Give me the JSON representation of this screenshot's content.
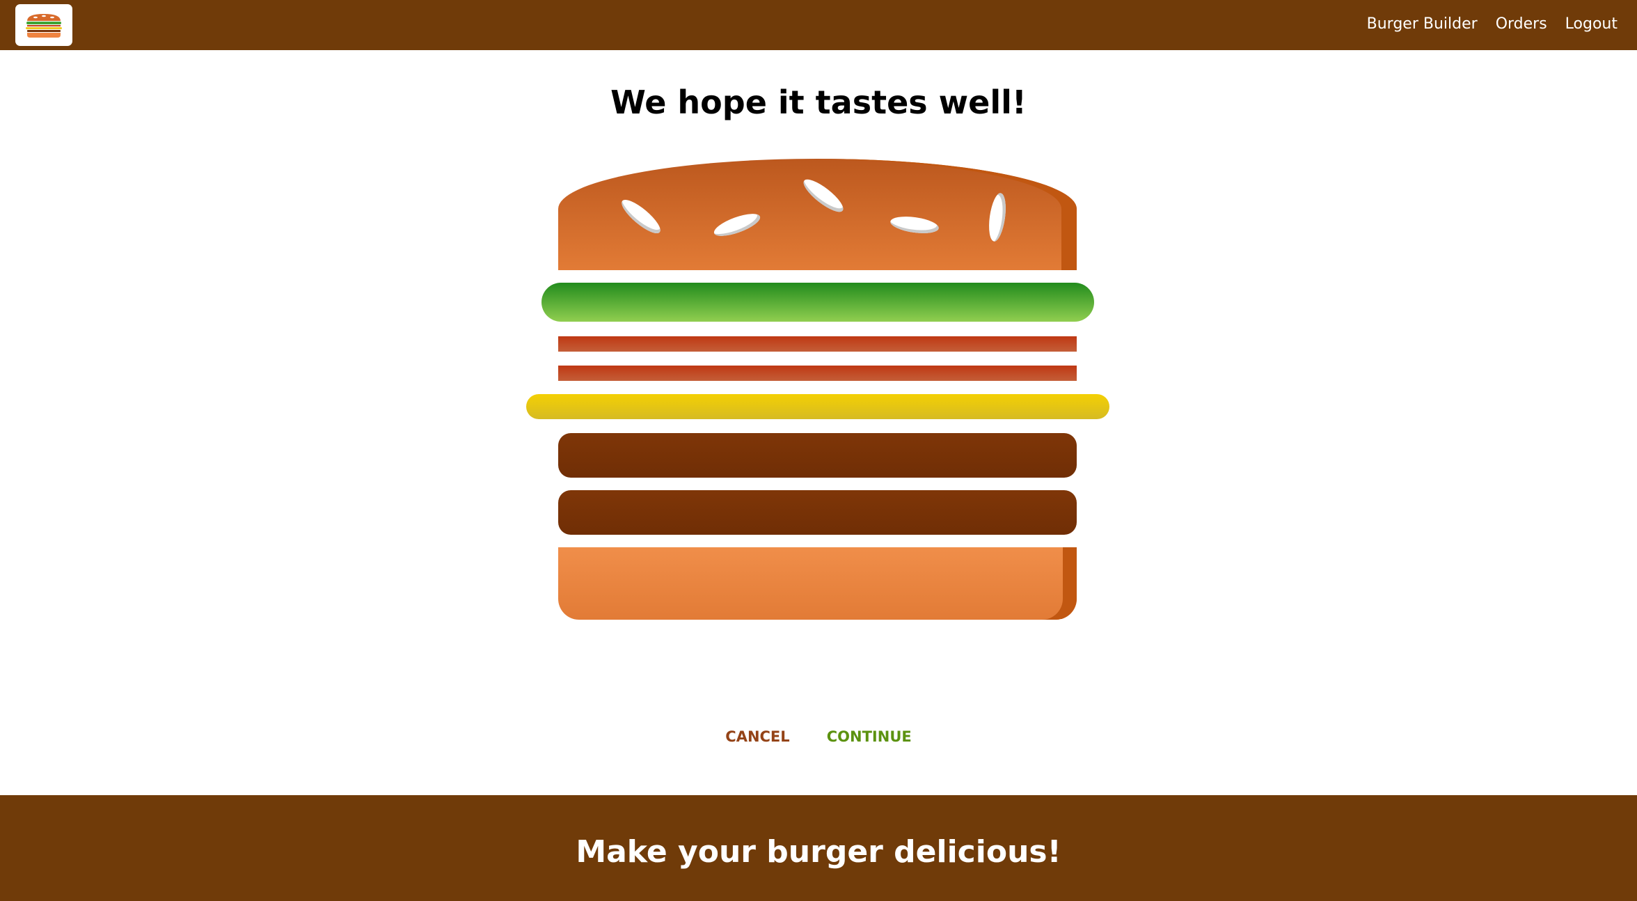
{
  "header": {
    "logo_icon": "burger-logo-icon",
    "nav": {
      "burger_builder": "Burger Builder",
      "orders": "Orders",
      "logout": "Logout"
    }
  },
  "main": {
    "title": "We hope it tastes well!",
    "burger_layers": [
      "bread-top",
      "salad",
      "bacon",
      "bacon",
      "cheese",
      "meat",
      "meat",
      "bread-bottom"
    ],
    "buttons": {
      "cancel": "CANCEL",
      "continue": "CONTINUE"
    }
  },
  "footer": {
    "title": "Make your burger delicious!"
  },
  "colors": {
    "toolbar": "#703b09",
    "cancel": "#944317",
    "continue": "#5c9210"
  }
}
